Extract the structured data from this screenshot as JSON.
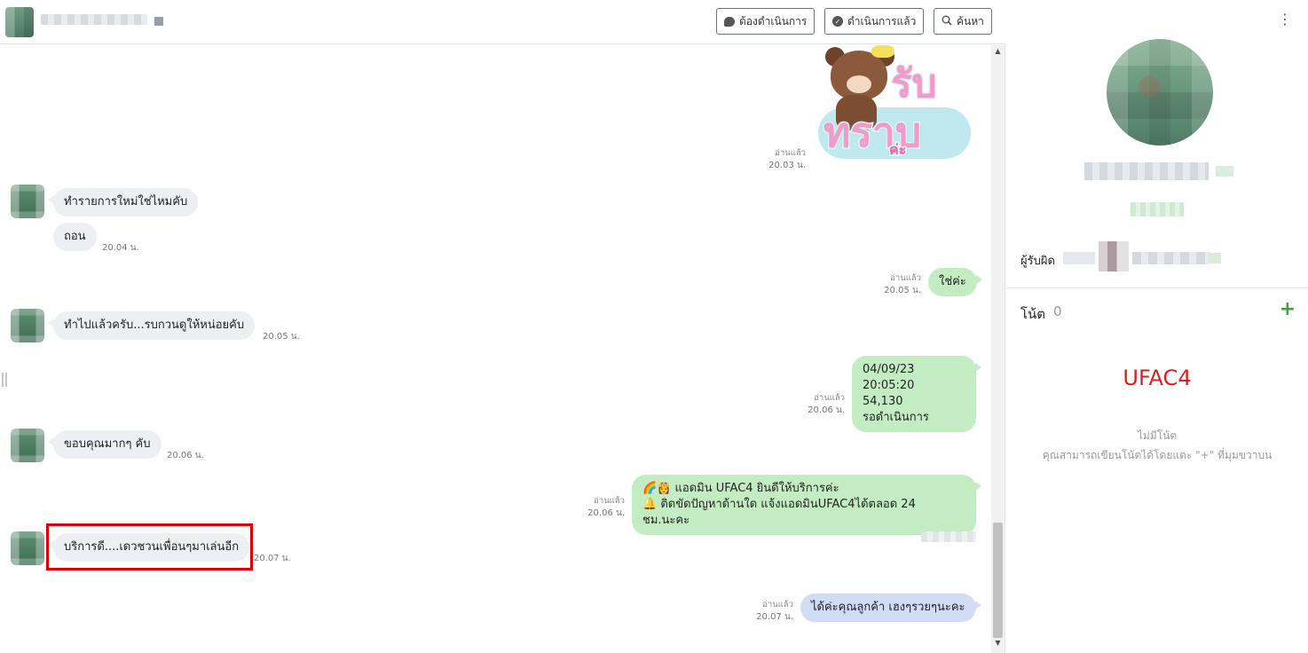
{
  "header": {
    "buttons": {
      "todo": "ต้องดำเนินการ",
      "done": "ดำเนินการแล้ว",
      "search": "ค้นหา"
    }
  },
  "messages": {
    "sticker": {
      "word1": "รับ",
      "word2": "ทราบ",
      "word3": "ค่ะ",
      "read": "อ่านแล้ว",
      "time": "20.03 น."
    },
    "m1": {
      "text": "ทำรายการใหม่ใช่ไหมคับ"
    },
    "m2": {
      "text": "ถอน",
      "time": "20.04 น."
    },
    "m3": {
      "text": "ใช่ค่ะ",
      "read": "อ่านแล้ว",
      "time": "20.05 น."
    },
    "m4": {
      "text": "ทำไปแล้วครับ...รบกวนดูให้หน่อยคับ",
      "time": "20.05 น."
    },
    "m5": {
      "line1": "04/09/23 20:05:20",
      "line2": "54,130",
      "line3": "รอดำเนินการ",
      "read": "อ่านแล้ว",
      "time": "20.06 น."
    },
    "m6": {
      "text": "ขอบคุณมากๆ คับ",
      "time": "20.06 น."
    },
    "m7": {
      "emoji1": "🌈👸",
      "line1": "แอดมิน UFAC4 ยินดีให้บริการค่ะ",
      "emoji2": "🔔",
      "line2": "ติดขัดปัญหาด้านใด แจ้งแอดมินUFAC4ได้ตลอด 24 ชม.นะคะ",
      "read": "อ่านแล้ว",
      "time": "20.06 น."
    },
    "m8": {
      "text": "บริการดี....เดวชวนเพื่อนๆมาเล่นอีก",
      "time": "20.07 น."
    },
    "m9": {
      "text": "ได้ค่ะคุณลูกค้า เฮงๆรวยๆนะคะ",
      "read": "อ่านแล้ว",
      "time": "20.07 น."
    }
  },
  "sidebar": {
    "owner_label": "ผู้รับผิด",
    "notes_title": "โน้ต",
    "notes_count": "0",
    "notes_add": "+",
    "tag": "UFAC4",
    "empty": "ไม่มีโน้ต",
    "hint": "คุณสามารถเขียนโน้ตได้โดยแตะ \"+\" ที่มุมขวาบน"
  },
  "colors": {
    "incoming_bubble": "#eeeff2",
    "outgoing_bubble": "#c4ecc2",
    "bot_bubble": "#d1dcf5",
    "highlight": "#e00000",
    "tag": "#dd1f1f",
    "add_icon": "#3aa63a"
  }
}
